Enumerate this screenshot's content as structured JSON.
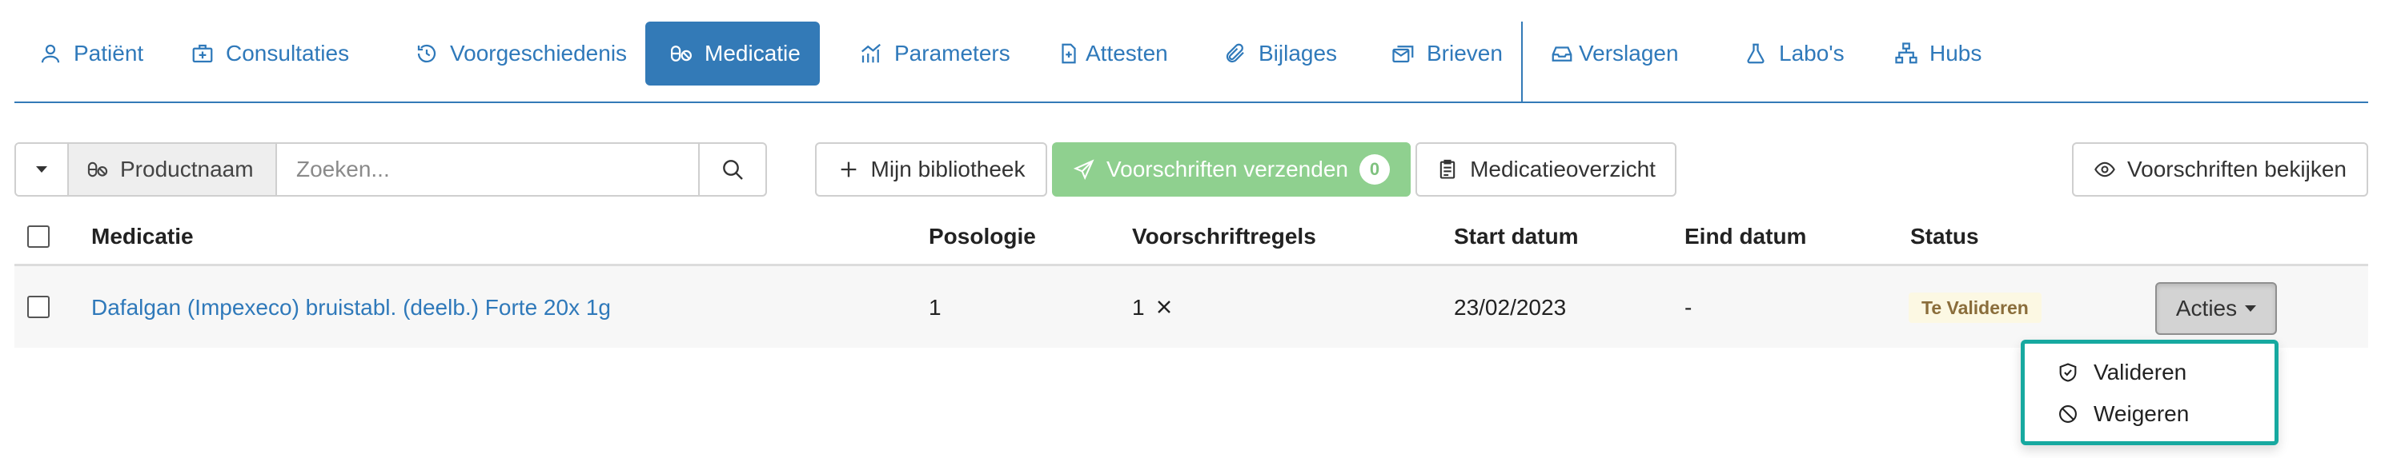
{
  "tabs": [
    {
      "label": "Patiënt",
      "icon": "user-icon"
    },
    {
      "label": "Consultaties",
      "icon": "medical-bag-icon"
    },
    {
      "label": "Voorgeschiedenis",
      "icon": "history-icon"
    },
    {
      "label": "Medicatie",
      "icon": "pills-icon",
      "active": true
    },
    {
      "label": "Parameters",
      "icon": "chart-icon"
    },
    {
      "label": "Attesten",
      "icon": "file-medical-icon"
    },
    {
      "label": "Bijlages",
      "icon": "paperclip-icon"
    },
    {
      "label": "Brieven",
      "icon": "mail-stack-icon"
    },
    {
      "label": "Verslagen",
      "icon": "inbox-icon"
    },
    {
      "label": "Labo's",
      "icon": "flask-icon"
    },
    {
      "label": "Hubs",
      "icon": "sitemap-icon"
    }
  ],
  "toolbar": {
    "product_label": "Productnaam",
    "search_placeholder": "Zoeken...",
    "library_label": "Mijn bibliotheek",
    "send_label": "Voorschriften verzenden",
    "send_count": "0",
    "overview_label": "Medicatieoverzicht",
    "view_label": "Voorschriften bekijken"
  },
  "table": {
    "columns": [
      "Medicatie",
      "Posologie",
      "Voorschriftregels",
      "Start datum",
      "Eind datum",
      "Status"
    ],
    "rows": [
      {
        "medication": "Dafalgan (Impexeco) bruistabl. (deelb.) Forte 20x 1g",
        "posology": "1",
        "prescription_lines": "1",
        "start_date": "23/02/2023",
        "end_date": "-",
        "status": "Te Valideren"
      }
    ]
  },
  "actions": {
    "button_label": "Acties",
    "menu": [
      {
        "label": "Valideren",
        "icon": "shield-check-icon"
      },
      {
        "label": "Weigeren",
        "icon": "ban-icon"
      }
    ]
  },
  "colors": {
    "accent": "#337ab7",
    "success": "#8fd08f",
    "status_warning_bg": "#fcf8e3",
    "status_warning_text": "#8a6d3b",
    "menu_border": "#17a9a0"
  }
}
